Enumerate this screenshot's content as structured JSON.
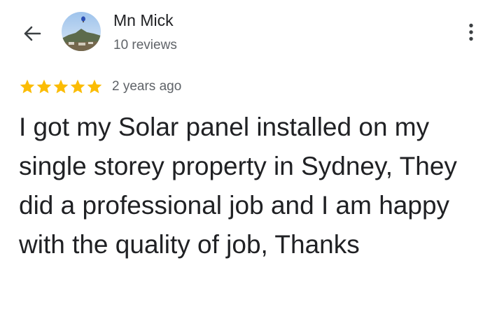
{
  "header": {
    "back_icon": "arrow-left-icon",
    "reviewer_name": "Mn Mick",
    "review_count": "10 reviews",
    "more_icon": "more-vert-icon"
  },
  "review": {
    "rating": 5,
    "rating_max": 5,
    "star_color": "#fbbc04",
    "date": "2 years ago",
    "text": "I got my Solar panel installed on my single storey property in Sydney, They did a professional job and I am happy with the quality of job, Thanks"
  }
}
